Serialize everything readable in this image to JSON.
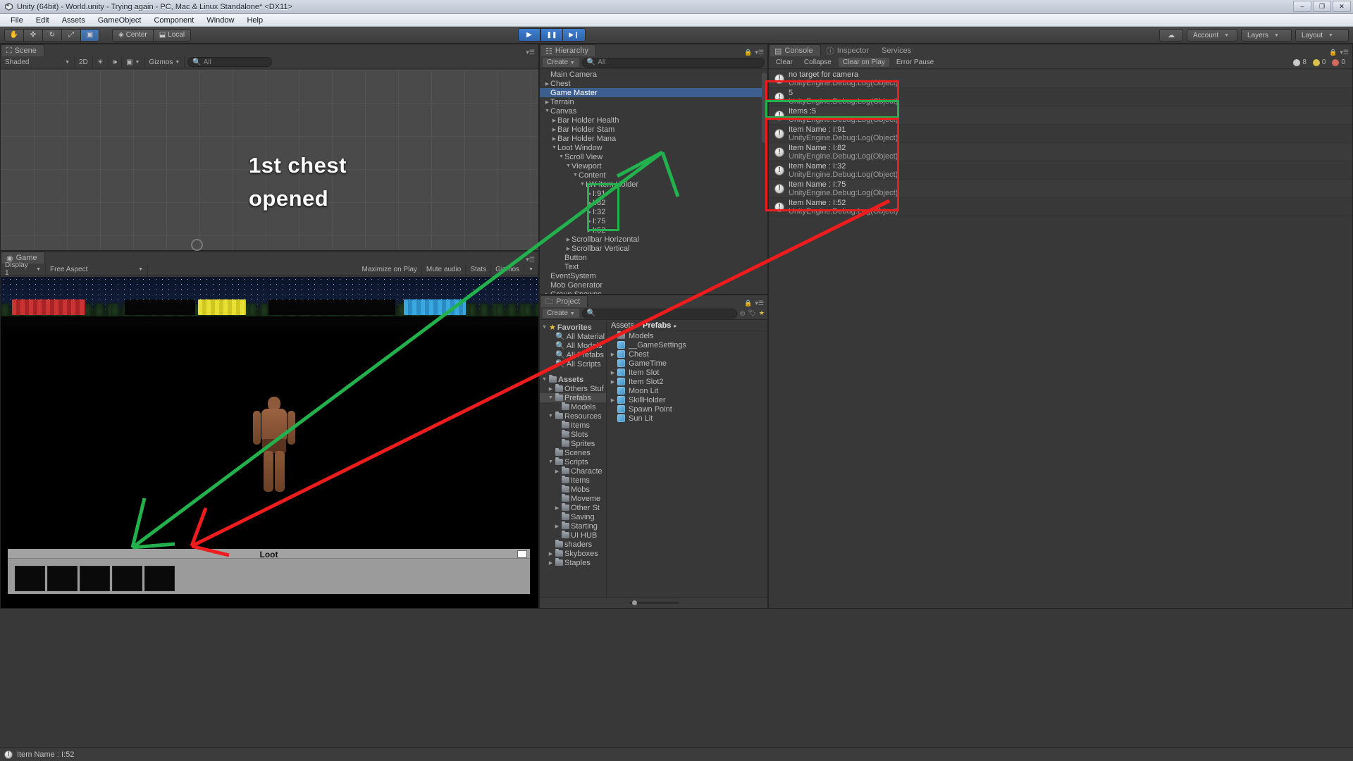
{
  "window": {
    "title": "Unity (64bit) - World.unity - Trying again - PC, Mac & Linux Standalone* <DX11>",
    "minimize": "–",
    "maximize": "❐",
    "close": "✕"
  },
  "menu": [
    "File",
    "Edit",
    "Assets",
    "GameObject",
    "Component",
    "Window",
    "Help"
  ],
  "toolbar": {
    "tools": [
      "hand-tool",
      "move-tool",
      "rotate-tool",
      "scale-tool",
      "rect-tool"
    ],
    "pivot": "Center",
    "space": "Local",
    "play": "▶",
    "pause": "❚❚",
    "step": "▶❙",
    "cloud": "☁",
    "account": "Account",
    "layers": "Layers",
    "layout": "Layout"
  },
  "scene": {
    "tab": "Scene",
    "draw_mode": "Shaded",
    "dimension": "2D",
    "lighting_icon": "sun-icon",
    "audio_icon": "audio-icon",
    "effects_icon": "effects-icon",
    "gizmos": "Gizmos",
    "search_placeholder": "All",
    "annotation_text_line1": "1st chest",
    "annotation_text_line2": "opened"
  },
  "game": {
    "tab": "Game",
    "display": "Display 1",
    "aspect": "Free Aspect",
    "maximize": "Maximize on Play",
    "mute": "Mute audio",
    "stats": "Stats",
    "gizmos": "Gizmos",
    "loot_title": "Loot",
    "slot_count": 5
  },
  "hierarchy": {
    "tab": "Hierarchy",
    "create": "Create",
    "search_placeholder": "All",
    "items": [
      {
        "label": "Main Camera",
        "depth": 0,
        "arrow": "none",
        "selected": false
      },
      {
        "label": "Chest",
        "depth": 0,
        "arrow": "closed",
        "selected": false
      },
      {
        "label": "Game Master",
        "depth": 0,
        "arrow": "none",
        "selected": true
      },
      {
        "label": "Terrain",
        "depth": 0,
        "arrow": "closed",
        "selected": false
      },
      {
        "label": "Canvas",
        "depth": 0,
        "arrow": "open",
        "selected": false
      },
      {
        "label": "Bar Holder Health",
        "depth": 1,
        "arrow": "closed",
        "selected": false
      },
      {
        "label": "Bar Holder Stam",
        "depth": 1,
        "arrow": "closed",
        "selected": false
      },
      {
        "label": "Bar Holder Mana",
        "depth": 1,
        "arrow": "closed",
        "selected": false
      },
      {
        "label": "Loot Window",
        "depth": 1,
        "arrow": "open",
        "selected": false
      },
      {
        "label": "Scroll View",
        "depth": 2,
        "arrow": "open",
        "selected": false
      },
      {
        "label": "Viewport",
        "depth": 3,
        "arrow": "open",
        "selected": false
      },
      {
        "label": "Content",
        "depth": 4,
        "arrow": "open",
        "selected": false
      },
      {
        "label": "LW item Holder",
        "depth": 5,
        "arrow": "open",
        "selected": false
      },
      {
        "label": "I:91",
        "depth": 6,
        "arrow": "closed",
        "selected": false
      },
      {
        "label": "I:82",
        "depth": 6,
        "arrow": "closed",
        "selected": false
      },
      {
        "label": "I:32",
        "depth": 6,
        "arrow": "closed",
        "selected": false
      },
      {
        "label": "I:75",
        "depth": 6,
        "arrow": "closed",
        "selected": false
      },
      {
        "label": "I:52",
        "depth": 6,
        "arrow": "closed",
        "selected": false
      },
      {
        "label": "Scrollbar Horizontal",
        "depth": 3,
        "arrow": "closed",
        "selected": false
      },
      {
        "label": "Scrollbar Vertical",
        "depth": 3,
        "arrow": "closed",
        "selected": false
      },
      {
        "label": "Button",
        "depth": 2,
        "arrow": "none",
        "selected": false
      },
      {
        "label": "Text",
        "depth": 2,
        "arrow": "none",
        "selected": false
      },
      {
        "label": "EventSystem",
        "depth": 0,
        "arrow": "none",
        "selected": false
      },
      {
        "label": "Mob Generator",
        "depth": 0,
        "arrow": "none",
        "selected": false
      },
      {
        "label": "Group Spawns",
        "depth": 0,
        "arrow": "closed",
        "selected": false
      }
    ]
  },
  "project": {
    "tab": "Project",
    "create": "Create",
    "search_placeholder": "",
    "favorites_label": "Favorites",
    "favorites": [
      "All Material",
      "All Models",
      "All Prefabs",
      "All Scripts"
    ],
    "assets_label": "Assets",
    "tree": [
      {
        "label": "Others Stuf",
        "depth": 1,
        "arrow": "closed",
        "selected": false
      },
      {
        "label": "Prefabs",
        "depth": 1,
        "arrow": "open",
        "selected": true
      },
      {
        "label": "Models",
        "depth": 2,
        "arrow": "none",
        "selected": false
      },
      {
        "label": "Resources",
        "depth": 1,
        "arrow": "open",
        "selected": false
      },
      {
        "label": "Items",
        "depth": 2,
        "arrow": "none",
        "selected": false
      },
      {
        "label": "Slots",
        "depth": 2,
        "arrow": "none",
        "selected": false
      },
      {
        "label": "Sprites",
        "depth": 2,
        "arrow": "none",
        "selected": false
      },
      {
        "label": "Scenes",
        "depth": 1,
        "arrow": "none",
        "selected": false
      },
      {
        "label": "Scripts",
        "depth": 1,
        "arrow": "open",
        "selected": false
      },
      {
        "label": "Characte",
        "depth": 2,
        "arrow": "closed",
        "selected": false
      },
      {
        "label": "Items",
        "depth": 2,
        "arrow": "none",
        "selected": false
      },
      {
        "label": "Mobs",
        "depth": 2,
        "arrow": "none",
        "selected": false
      },
      {
        "label": "Moveme",
        "depth": 2,
        "arrow": "none",
        "selected": false
      },
      {
        "label": "Other St",
        "depth": 2,
        "arrow": "closed",
        "selected": false
      },
      {
        "label": "Saving",
        "depth": 2,
        "arrow": "none",
        "selected": false
      },
      {
        "label": "Starting",
        "depth": 2,
        "arrow": "closed",
        "selected": false
      },
      {
        "label": "UI HUB",
        "depth": 2,
        "arrow": "none",
        "selected": false
      },
      {
        "label": "shaders",
        "depth": 1,
        "arrow": "none",
        "selected": false
      },
      {
        "label": "Skyboxes",
        "depth": 1,
        "arrow": "closed",
        "selected": false
      },
      {
        "label": "Staples",
        "depth": 1,
        "arrow": "closed",
        "selected": false
      }
    ],
    "breadcrumb": [
      "Assets",
      "Prefabs"
    ],
    "contents": [
      {
        "label": "Models",
        "icon": "folder",
        "arrow": "none"
      },
      {
        "label": "__GameSettings",
        "icon": "prefab",
        "arrow": "none"
      },
      {
        "label": "Chest",
        "icon": "prefab",
        "arrow": "closed"
      },
      {
        "label": "GameTime",
        "icon": "prefab",
        "arrow": "none"
      },
      {
        "label": "Item Slot",
        "icon": "prefab",
        "arrow": "closed"
      },
      {
        "label": "Item Slot2",
        "icon": "prefab",
        "arrow": "closed"
      },
      {
        "label": "Moon Lit",
        "icon": "prefab",
        "arrow": "none"
      },
      {
        "label": "SkillHolder",
        "icon": "prefab",
        "arrow": "closed"
      },
      {
        "label": "Spawn Point",
        "icon": "prefab",
        "arrow": "none"
      },
      {
        "label": "Sun Lit",
        "icon": "prefab",
        "arrow": "none"
      }
    ]
  },
  "console": {
    "tabs": [
      {
        "label": "Console",
        "active": true
      },
      {
        "label": "Inspector",
        "active": false
      },
      {
        "label": "Services",
        "active": false
      }
    ],
    "buttons": [
      "Clear",
      "Collapse",
      "Clear on Play",
      "Error Pause"
    ],
    "counts": {
      "info": "8",
      "warn": "0",
      "error": "0"
    },
    "messages": [
      {
        "line1": "no target for camera",
        "line2": "UnityEngine.Debug:Log(Object)"
      },
      {
        "line1": "5",
        "line2": "UnityEngine.Debug:Log(Object)"
      },
      {
        "line1": "Items :5",
        "line2": "UnityEngine.Debug:Log(Object)"
      },
      {
        "line1": "Item Name : I:91",
        "line2": "UnityEngine.Debug:Log(Object)"
      },
      {
        "line1": "Item Name : I:82",
        "line2": "UnityEngine.Debug:Log(Object)"
      },
      {
        "line1": "Item Name : I:32",
        "line2": "UnityEngine.Debug:Log(Object)"
      },
      {
        "line1": "Item Name : I:75",
        "line2": "UnityEngine.Debug:Log(Object)"
      },
      {
        "line1": "Item Name : I:52",
        "line2": "UnityEngine.Debug:Log(Object)"
      }
    ]
  },
  "statusbar": {
    "message": "Item Name : I:52"
  },
  "annotations": {
    "red_color": "#ee1c1c",
    "green_color": "#22b14c"
  }
}
